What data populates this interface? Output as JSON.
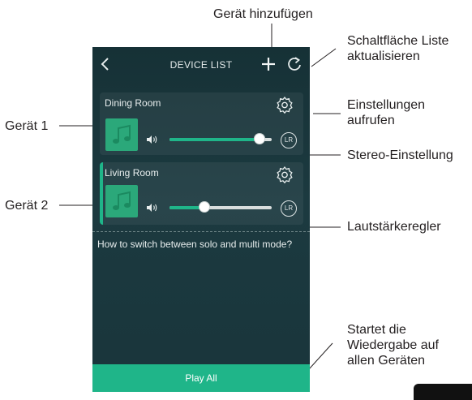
{
  "annotations": {
    "add_device": "Gerät hinzufügen",
    "refresh_list_line1": "Schaltfläche Liste",
    "refresh_list_line2": "aktualisieren",
    "settings_line1": "Einstellungen",
    "settings_line2": "aufrufen",
    "stereo": "Stereo-Einstellung",
    "volume": "Lautstärkeregler",
    "play_all_line1": "Startet die",
    "play_all_line2": "Wiedergabe auf",
    "play_all_line3": "allen Geräten",
    "device1": "Gerät 1",
    "device2": "Gerät 2"
  },
  "header": {
    "title": "DEVICE LIST",
    "back_icon": "chevron-left-icon",
    "add_icon": "plus-icon",
    "refresh_icon": "refresh-icon"
  },
  "devices": [
    {
      "name": "Dining Room",
      "volume": 0.88,
      "channel_label": "LR",
      "active": false
    },
    {
      "name": "Living Room",
      "volume": 0.34,
      "channel_label": "LR",
      "active": true
    }
  ],
  "help_text": "How to switch between solo and multi mode?",
  "play_all_label": "Play All",
  "colors": {
    "accent": "#1fb589",
    "background": "#1a363c",
    "artwork": "#2ba87a"
  }
}
